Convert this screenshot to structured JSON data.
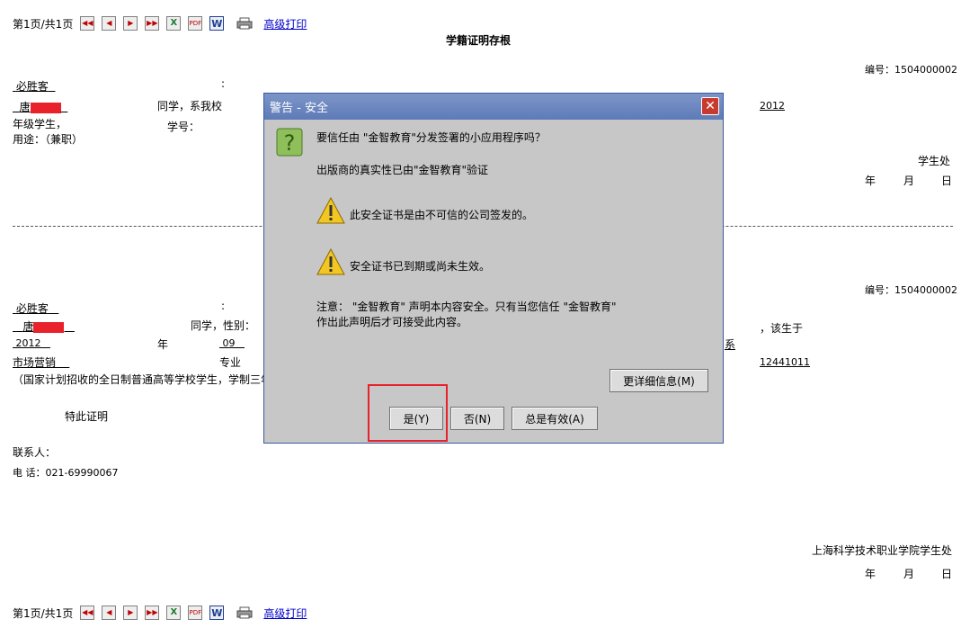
{
  "toolbar": {
    "page_info": "第1页/共1页",
    "buttons": [
      "first-page-icon",
      "prev-page-icon",
      "next-page-icon",
      "last-page-icon",
      "excel-export-icon",
      "pdf-export-icon",
      "word-export-icon",
      "print-icon"
    ],
    "advanced_print": "高级打印"
  },
  "stub": {
    "title": "学籍证明存根",
    "number": "编号：1504000002",
    "company": "必胜客",
    "colon": ":",
    "name_prefix": "唐",
    "student_text": "同学，系我校",
    "year": "2012",
    "grade_student": "年级学生，",
    "student_id_label": "学号：",
    "purpose": "用途：（兼职）",
    "office": "学生处",
    "date_year": "年",
    "date_month": "月",
    "date_day": "日"
  },
  "cert": {
    "number": "编号：1504000002",
    "company": "必胜客",
    "colon": ":",
    "name_prefix": "唐",
    "student_gender": "同学，性别：",
    "born": "，该生于",
    "year": "2012",
    "year_label": "年",
    "month": "09",
    "dept_suffix": "系",
    "major": "市场营销",
    "major_label": "专业",
    "class_no": "12441011",
    "note": "（国家计划招收的全日制普通高等学校学生，学制三年",
    "certify": "特此证明",
    "contact_label": "联系人：",
    "phone": "电  话：021-69990067",
    "school_office": "上海科学技术职业学院学生处",
    "date_year": "年",
    "date_month": "月",
    "date_day": "日"
  },
  "dialog": {
    "title": "警告 - 安全",
    "question": "要信任由 \"金智教育\"分发签署的小应用程序吗？",
    "publisher": "出版商的真实性已由\"金智教育\"验证",
    "warning1": "此安全证书是由不可信的公司签发的。",
    "warning2": "安全证书已到期或尚未生效。",
    "notice1": "注意：  \"金智教育\" 声明本内容安全。只有当您信任 \"金智教育\"",
    "notice2": "作出此声明后才可接受此内容。",
    "details_button": "更详细信息(M)",
    "yes_button": "是(Y)",
    "no_button": "否(N)",
    "always_button": "总是有效(A)",
    "close_symbol": "✕"
  }
}
